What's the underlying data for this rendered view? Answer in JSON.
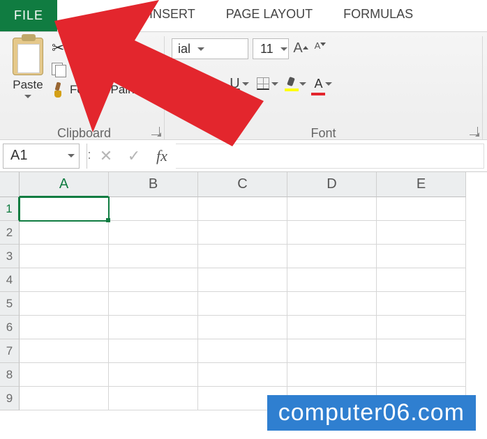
{
  "tabs": {
    "file": "FILE",
    "insert": "INSERT",
    "page_layout": "PAGE LAYOUT",
    "formulas": "FORMULAS"
  },
  "clipboard": {
    "paste_label": "Paste",
    "copy_label": "C",
    "format_painter": "Format Painter",
    "group_label": "Clipboard"
  },
  "font": {
    "name_visible": "ial",
    "size": "11",
    "group_label": "Font"
  },
  "formula_bar": {
    "cell_ref": "A1",
    "cancel_glyph": "✕",
    "enter_glyph": "✓",
    "fx_label": "fx"
  },
  "columns": [
    "A",
    "B",
    "C",
    "D",
    "E"
  ],
  "rows": [
    "1",
    "2",
    "3",
    "4",
    "5",
    "6",
    "7",
    "8",
    "9"
  ],
  "selected_cell": "A1",
  "colors": {
    "excel_green": "#107c41",
    "arrow_red": "#e3262d",
    "highlight_yellow": "#ffff00",
    "watermark_blue": "#2f7fd0"
  },
  "watermark": "computer06.com"
}
